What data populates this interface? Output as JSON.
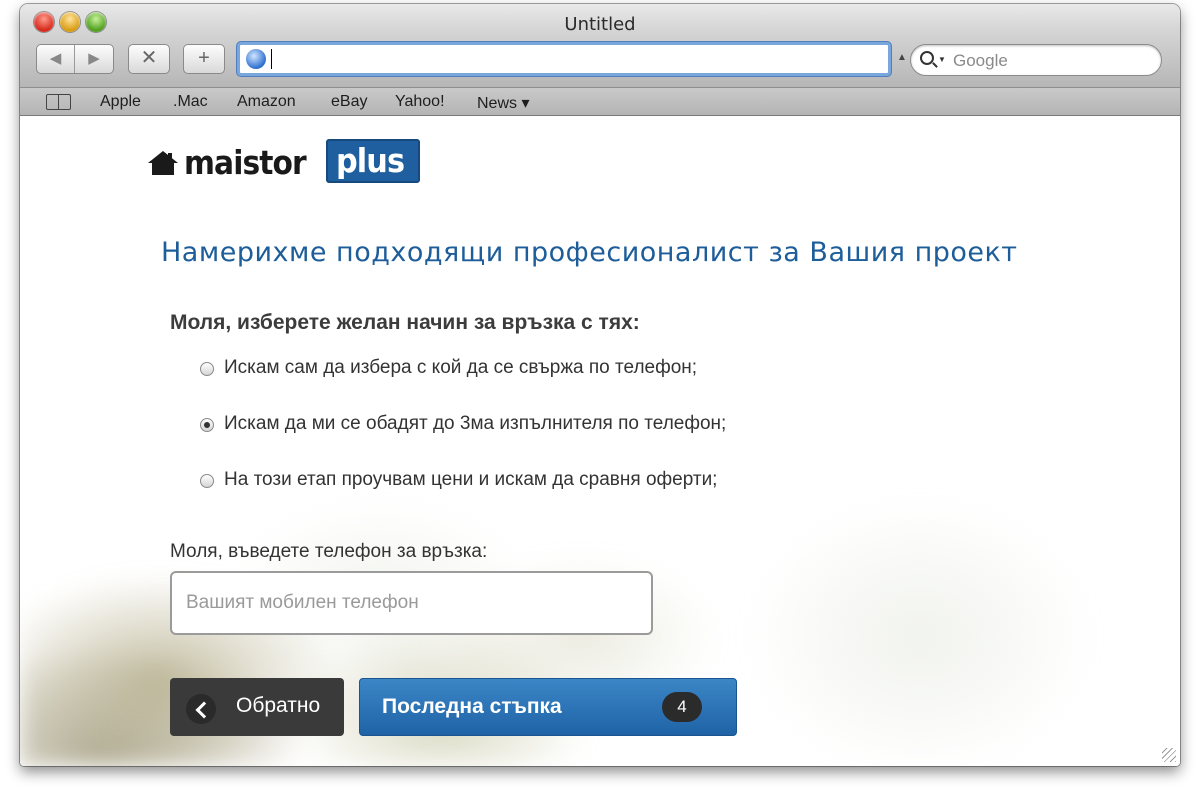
{
  "window": {
    "title": "Untitled"
  },
  "toolbar": {
    "back_icon": "back-arrow-icon",
    "forward_icon": "forward-arrow-icon",
    "stop_label": "✕",
    "add_label": "+",
    "url_value": "",
    "search_placeholder": "Google"
  },
  "bookmarks": {
    "icon": "book-icon",
    "items": [
      "Apple",
      ".Mac",
      "Amazon",
      "eBay",
      "Yahoo!",
      "News ▾"
    ]
  },
  "page": {
    "logo": {
      "word": "maistor",
      "plus": "plus"
    },
    "heading": "Намерихме подходящи професионалист за Вашия проект",
    "question": "Моля, изберете желан начин за връзка с тях:",
    "options": [
      {
        "label": "Искам сам да избера с кой да се свържа по телефон;",
        "checked": false
      },
      {
        "label": "Искам да ми се обадят до 3ма изпълнителя по телефон;",
        "checked": true
      },
      {
        "label": "На този етап проучвам цени и искам да сравня оферти;",
        "checked": false
      }
    ],
    "phone_label": "Моля, въведете телефон за връзка:",
    "phone_placeholder": "Вашият мобилен телефон",
    "phone_value": "",
    "back_button": "Обратно",
    "next_button": "Последна стъпка",
    "step_number": "4"
  },
  "colors": {
    "brand_blue": "#1f5f9f",
    "heading_blue": "#1d5d9a",
    "button_blue": "#2d76b8",
    "button_dark": "#3a3a3a"
  }
}
